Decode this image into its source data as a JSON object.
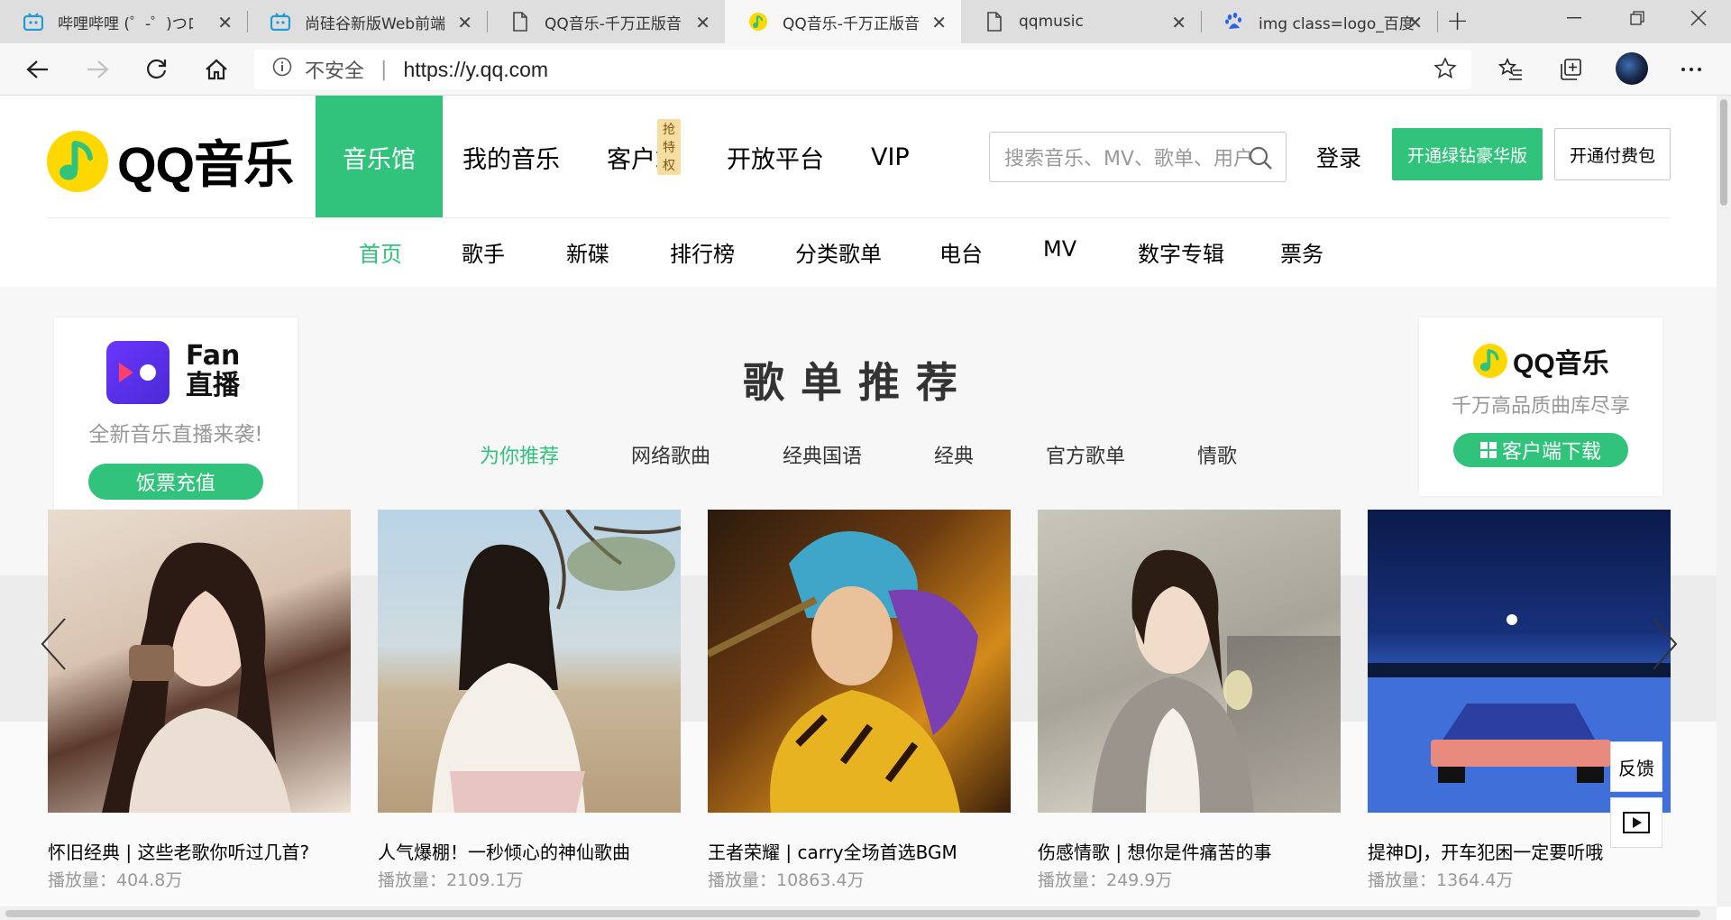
{
  "browser": {
    "tabs": [
      {
        "title": "哔哩哔哩 (゜-゜)つロ",
        "icon": "bilibili-icon"
      },
      {
        "title": "尚硅谷新版Web前端",
        "icon": "bilibili-icon"
      },
      {
        "title": "QQ音乐-千万正版音",
        "icon": "document-icon"
      },
      {
        "title": "QQ音乐-千万正版音",
        "icon": "qqmusic-icon"
      },
      {
        "title": "qqmusic",
        "icon": "document-icon"
      },
      {
        "title": "img class=logo_百度",
        "icon": "baidu-icon"
      }
    ],
    "active_tab_index": 3,
    "address": {
      "security_label": "不安全",
      "url": "https://y.qq.com"
    }
  },
  "header": {
    "logo_text": "QQ音乐",
    "nav": [
      {
        "label": "音乐馆"
      },
      {
        "label": "我的音乐"
      },
      {
        "label": "客户端"
      },
      {
        "label": "开放平台"
      },
      {
        "label": "VIP"
      }
    ],
    "client_badge": "抢特权",
    "search_placeholder": "搜索音乐、MV、歌单、用户",
    "login_label": "登录",
    "vip_button": "开通绿钻豪华版",
    "paid_button": "开通付费包"
  },
  "subnav": [
    {
      "label": "首页"
    },
    {
      "label": "歌手"
    },
    {
      "label": "新碟"
    },
    {
      "label": "排行榜"
    },
    {
      "label": "分类歌单"
    },
    {
      "label": "电台"
    },
    {
      "label": "MV"
    },
    {
      "label": "数字专辑"
    },
    {
      "label": "票务"
    }
  ],
  "fan_card": {
    "title_line1": "Fan",
    "title_line2": "直播",
    "subtitle": "全新音乐直播来袭!",
    "button": "饭票充值"
  },
  "qq_card": {
    "logo_text": "QQ音乐",
    "subtitle": "千万高品质曲库尽享",
    "button": "客户端下载"
  },
  "section": {
    "title": "歌单推荐",
    "categories": [
      {
        "label": "为你推荐"
      },
      {
        "label": "网络歌曲"
      },
      {
        "label": "经典国语"
      },
      {
        "label": "经典"
      },
      {
        "label": "官方歌单"
      },
      {
        "label": "情歌"
      }
    ]
  },
  "playlists": [
    {
      "title": "怀旧经典 | 这些老歌你听过几首?",
      "plays": "播放量：404.8万"
    },
    {
      "title": "人气爆棚！一秒倾心的神仙歌曲",
      "plays": "播放量：2109.1万"
    },
    {
      "title": "王者荣耀 | carry全场首选BGM",
      "plays": "播放量：10863.4万"
    },
    {
      "title": "伤感情歌 | 想你是件痛苦的事",
      "plays": "播放量：249.9万"
    },
    {
      "title": "提神DJ，开车犯困一定要听哦",
      "plays": "播放量：1364.4万"
    }
  ],
  "floating": {
    "feedback": "反馈"
  },
  "colors": {
    "brand_green": "#31c27c",
    "logo_yellow": "#ffd800"
  }
}
